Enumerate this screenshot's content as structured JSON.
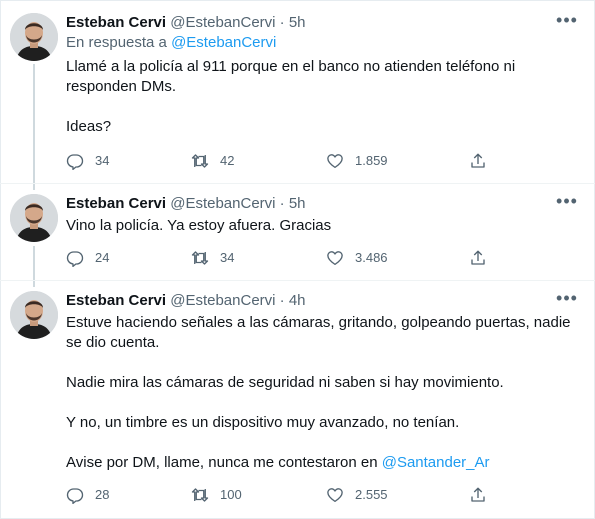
{
  "author": {
    "name": "Esteban Cervi",
    "handle": "@EstebanCervi",
    "dot": "·"
  },
  "tweets": [
    {
      "time": "5h",
      "reply_prefix": "En respuesta a",
      "reply_mention": "@EstebanCervi",
      "paragraphs": [
        "Llamé a la policía al 911 porque en el banco no atienden teléfono ni responden DMs.",
        "Ideas?"
      ],
      "replies": "34",
      "retweets": "42",
      "likes": "1.859"
    },
    {
      "time": "5h",
      "paragraphs": [
        "Vino la policía. Ya estoy afuera. Gracias"
      ],
      "replies": "24",
      "retweets": "34",
      "likes": "3.486"
    },
    {
      "time": "4h",
      "paragraphs": [
        "Estuve haciendo señales a las cámaras, gritando, golpeando puertas, nadie se dio cuenta.",
        "Nadie mira las cámaras de seguridad ni saben si hay movimiento.",
        "Y no, un timbre es un dispositivo muy avanzado, no tenían."
      ],
      "last_paragraph_prefix": "Avise por DM, llame, nunca me contestaron en ",
      "last_paragraph_mention": "@Santander_Ar",
      "replies": "28",
      "retweets": "100",
      "likes": "2.555"
    }
  ],
  "colors": {
    "accent": "#1d9bf0",
    "secondary_text": "#536471",
    "primary_text": "#0f1419",
    "thread_line": "#cfd9de"
  },
  "icons": [
    "reply-icon",
    "retweet-icon",
    "like-icon",
    "share-icon",
    "more-icon"
  ]
}
